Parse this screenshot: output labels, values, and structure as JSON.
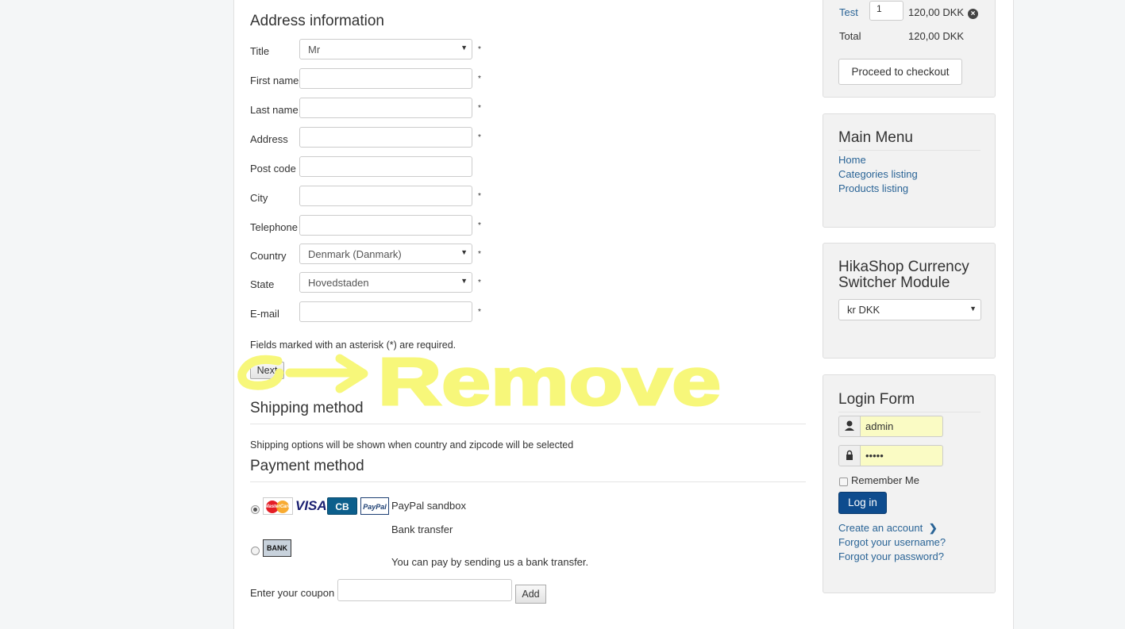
{
  "address": {
    "title": "Address information",
    "fields": [
      {
        "label": "Title",
        "type": "select",
        "value": "Mr",
        "required": "*"
      },
      {
        "label": "First name",
        "type": "text",
        "value": "",
        "required": "*"
      },
      {
        "label": "Last name",
        "type": "text",
        "value": "",
        "required": "*"
      },
      {
        "label": "Address",
        "type": "text",
        "value": "",
        "required": "*"
      },
      {
        "label": "Post code",
        "type": "text",
        "value": "",
        "required": ""
      },
      {
        "label": "City",
        "type": "text",
        "value": "",
        "required": "*"
      },
      {
        "label": "Telephone",
        "type": "text",
        "value": "",
        "required": "*"
      },
      {
        "label": "Country",
        "type": "select",
        "value": "Denmark (Danmark)",
        "required": "*"
      },
      {
        "label": "State",
        "type": "select",
        "value": "Hovedstaden",
        "required": "*"
      },
      {
        "label": "E-mail",
        "type": "text",
        "value": "",
        "required": "*"
      }
    ],
    "required_note": "Fields marked with an asterisk (*) are required.",
    "next_label": "Next"
  },
  "shipping": {
    "title": "Shipping method",
    "info": "Shipping options will be shown when country and zipcode will be selected"
  },
  "payment": {
    "title": "Payment method",
    "paypal_label": "PayPal sandbox",
    "bank_label": "Bank transfer",
    "bank_desc": "You can pay by sending us a bank transfer.",
    "card_mastercard": "MasterCard",
    "card_visa": "VISA",
    "card_cb": "CB",
    "card_paypal": "PayPal",
    "bank_logo": "BANK"
  },
  "coupon": {
    "label": "Enter your coupon",
    "add_label": "Add"
  },
  "cart": {
    "item_name": "Test",
    "qty": "1",
    "item_price": "120,00 DKK",
    "total_label": "Total",
    "total_value": "120,00 DKK",
    "checkout_label": "Proceed to checkout"
  },
  "main_menu": {
    "title": "Main Menu",
    "items": [
      "Home",
      "Categories listing",
      "Products listing"
    ]
  },
  "currency": {
    "title_line1": "HikaShop Currency",
    "title_line2": "Switcher Module",
    "value": "kr DKK"
  },
  "login": {
    "title": "Login Form",
    "username": "admin",
    "password": "•••••",
    "remember": "Remember Me",
    "login_label": "Log in",
    "create": "Create an account",
    "forgot_user": "Forgot your username?",
    "forgot_pass": "Forgot your password?"
  },
  "annotation": {
    "text": "Remove",
    "color": "#f7f77a"
  }
}
